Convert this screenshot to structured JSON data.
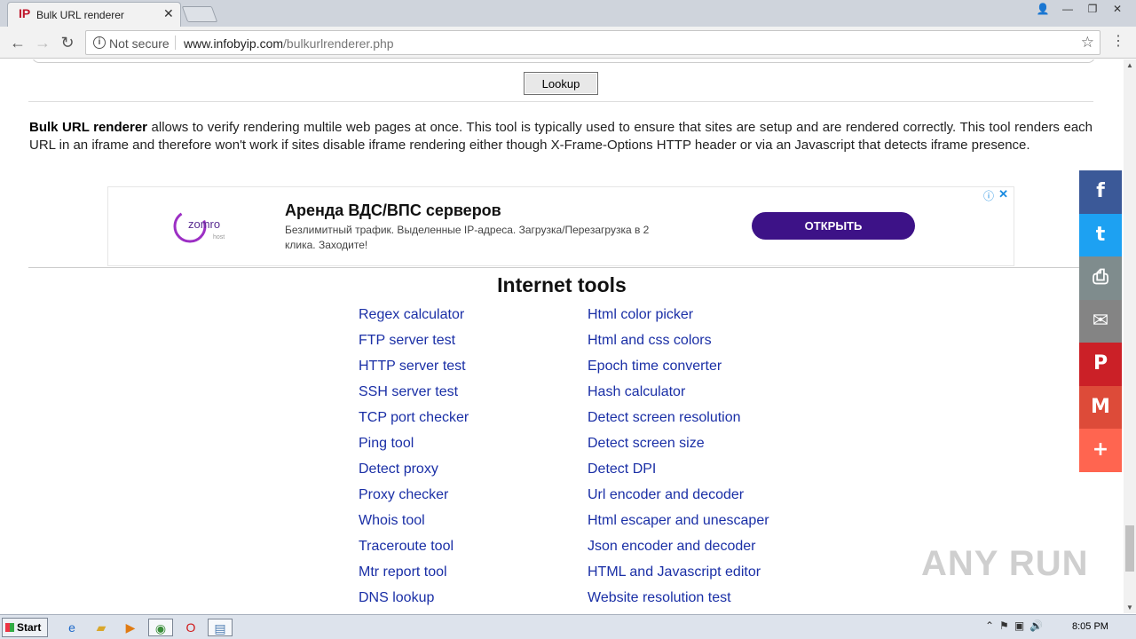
{
  "browser": {
    "tab_favicon": "IP",
    "tab_title": "Bulk URL renderer",
    "security_label": "Not secure",
    "url_host": "www.infobyip.com",
    "url_path": "/bulkurlrenderer.php"
  },
  "page": {
    "lookup_label": "Lookup",
    "description_bold": "Bulk URL renderer",
    "description_rest": " allows to verify rendering multile web pages at once. This tool is typically used to ensure that sites are setup and are rendered correctly. This tool renders each URL in an iframe and therefore won't work if sites disable iframe rendering either though X-Frame-Options HTTP header or via an Javascript that detects iframe presence."
  },
  "ad": {
    "logo_text": "zomro",
    "logo_sub": "host",
    "title": "Аренда ВДС/ВПС серверов",
    "text": "Безлимитный трафик. Выделенные IP-адреса. Загрузка/Перезагрузка в 2 клика. Заходите!",
    "cta": "ОТКРЫТЬ"
  },
  "tools": {
    "title": "Internet tools",
    "col1": [
      "Regex calculator",
      "FTP server test",
      "HTTP server test",
      "SSH server test",
      "TCP port checker",
      "Ping tool",
      "Detect proxy",
      "Proxy checker",
      "Whois tool",
      "Traceroute tool",
      "Mtr report tool",
      "DNS lookup"
    ],
    "col2": [
      "Html color picker",
      "Html and css colors",
      "Epoch time converter",
      "Hash calculator",
      "Detect screen resolution",
      "Detect screen size",
      "Detect DPI",
      "Url encoder and decoder",
      "Html escaper and unescaper",
      "Json encoder and decoder",
      "HTML and Javascript editor",
      "Website resolution test"
    ]
  },
  "share": [
    {
      "icon": "facebook-icon",
      "glyph": "f",
      "color": "#3b5998"
    },
    {
      "icon": "twitter-icon",
      "glyph": "t",
      "color": "#1da1f2"
    },
    {
      "icon": "print-icon",
      "glyph": "⎙",
      "color": "#7f8c8d"
    },
    {
      "icon": "email-icon",
      "glyph": "✉",
      "color": "#848484"
    },
    {
      "icon": "pinterest-icon",
      "glyph": "P",
      "color": "#cb2027"
    },
    {
      "icon": "gmail-icon",
      "glyph": "M",
      "color": "#dd4b39"
    },
    {
      "icon": "more-icon",
      "glyph": "+",
      "color": "#ff6550"
    }
  ],
  "watermark": "ANY RUN",
  "taskbar": {
    "start_label": "Start",
    "time": "8:05 PM"
  }
}
